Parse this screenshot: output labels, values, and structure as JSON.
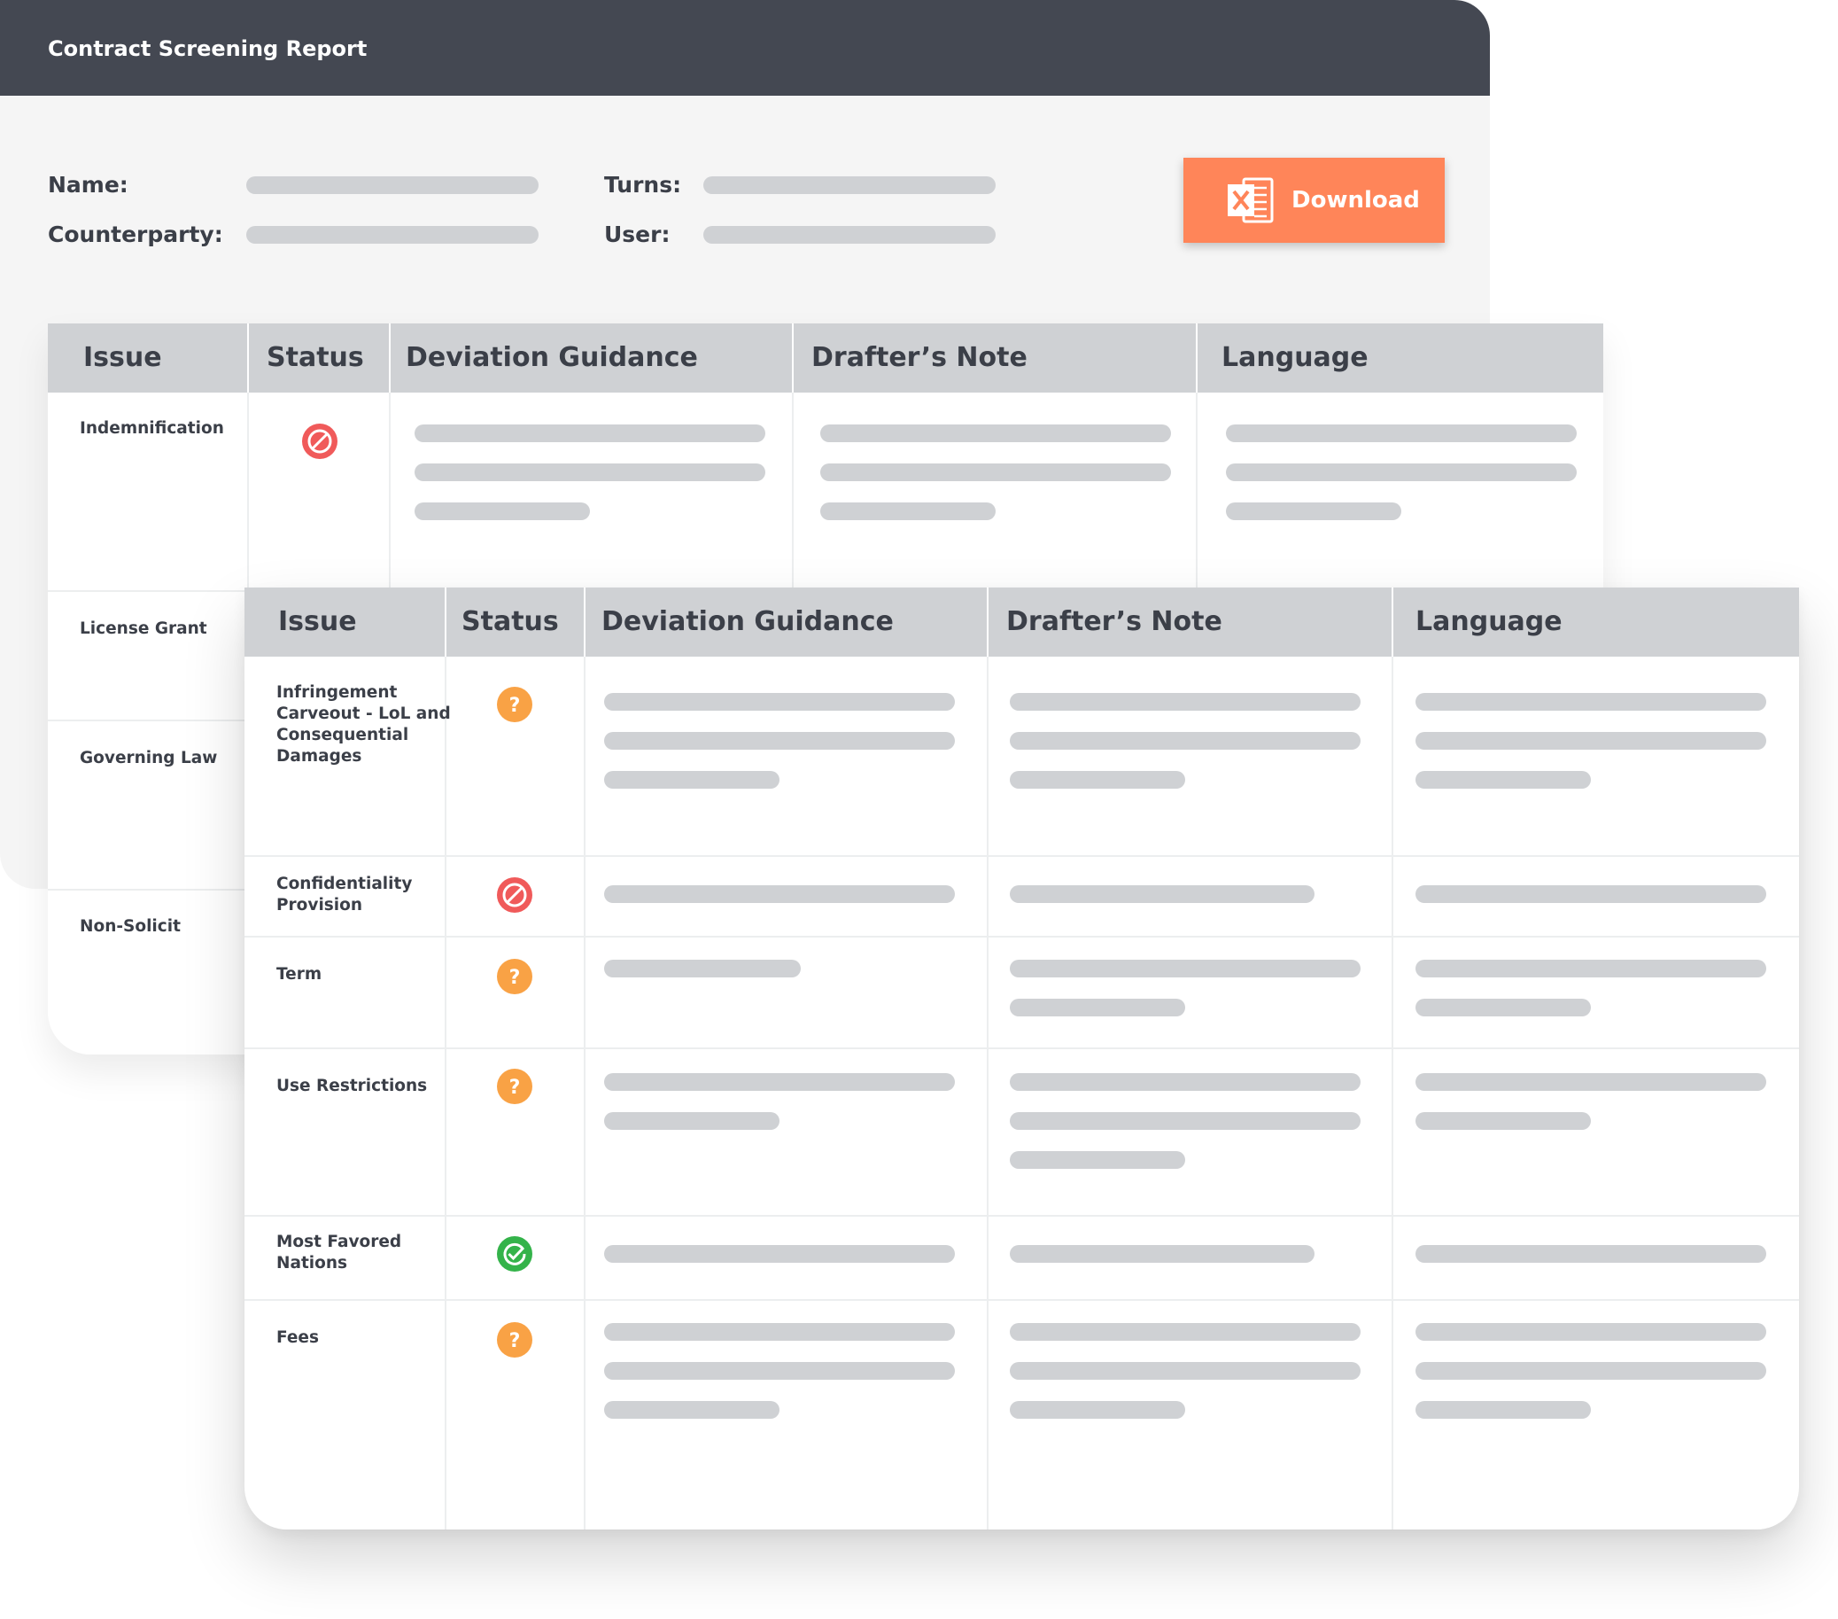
{
  "report": {
    "title": "Contract Screening Report",
    "fields": {
      "name_label": "Name:",
      "counterparty_label": "Counterparty:",
      "turns_label": "Turns:",
      "user_label": "User:"
    },
    "download": {
      "label": "Download",
      "icon": "excel-icon",
      "color": "#ff8559"
    }
  },
  "columns": [
    "Issue",
    "Status",
    "Deviation Guidance",
    "Drafter’s Note",
    "Language"
  ],
  "back_table": {
    "rows": [
      {
        "issue": "Indemnification",
        "status": "blocked"
      },
      {
        "issue": "License Grant"
      },
      {
        "issue": "Governing Law"
      },
      {
        "issue": "Non-Solicit"
      }
    ]
  },
  "front_table": {
    "rows": [
      {
        "issue": "Infringement Carveout - LoL and Consequential Damages",
        "issue_lines": [
          "Infringement",
          "Carveout - LoL and",
          "Consequential",
          "Damages"
        ],
        "status": "question"
      },
      {
        "issue": "Confidentiality Provision",
        "issue_lines": [
          "Confidentiality",
          "Provision"
        ],
        "status": "blocked"
      },
      {
        "issue": "Term",
        "issue_lines": [
          "Term"
        ],
        "status": "question"
      },
      {
        "issue": "Use Restrictions",
        "issue_lines": [
          "Use Restrictions"
        ],
        "status": "question"
      },
      {
        "issue": "Most Favored Nations",
        "issue_lines": [
          "Most Favored",
          "Nations"
        ],
        "status": "ok"
      },
      {
        "issue": "Fees",
        "issue_lines": [
          "Fees"
        ],
        "status": "question"
      }
    ]
  },
  "status_colors": {
    "blocked": "#f05a5a",
    "question": "#f9a245",
    "ok": "#34b34a"
  },
  "header_color": "#444852"
}
